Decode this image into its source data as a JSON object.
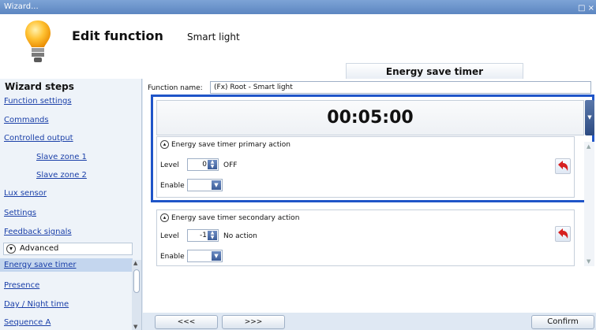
{
  "window": {
    "title": "Wizard...",
    "restore_glyph": "□ ×"
  },
  "header": {
    "title": "Edit function",
    "subtitle": "Smart light",
    "tab": "Energy save timer"
  },
  "sidebar": {
    "title": "Wizard steps",
    "items": [
      {
        "label": "Function settings"
      },
      {
        "label": "Commands"
      },
      {
        "label": "Controlled output"
      },
      {
        "label": "Slave zone 1"
      },
      {
        "label": "Slave zone 2"
      },
      {
        "label": "Lux sensor"
      },
      {
        "label": "Settings"
      },
      {
        "label": "Feedback signals"
      }
    ],
    "advanced_label": "Advanced",
    "advanced_items": [
      {
        "label": "Energy save timer"
      },
      {
        "label": "Presence"
      },
      {
        "label": "Day / Night time"
      },
      {
        "label": "Sequence A"
      }
    ]
  },
  "main": {
    "function_name_label": "Function name:",
    "function_name_value": "(Fx) Root - Smart light",
    "timer_value": "00:05:00",
    "primary": {
      "header": "Energy save timer primary action",
      "level_label": "Level",
      "level_value": "0",
      "level_state": "OFF",
      "enable_label": "Enable"
    },
    "secondary": {
      "header": "Energy save timer secondary action",
      "level_label": "Level",
      "level_value": "-1",
      "level_state": "No action",
      "enable_label": "Enable"
    }
  },
  "footer": {
    "prev_label": "<<<",
    "next_label": ">>>",
    "confirm_label": "Confirm"
  },
  "colors": {
    "accent": "#1f55c8",
    "titlebar": "#6b93cc",
    "link": "#1a3fa8",
    "reset_arrow": "#d62020"
  }
}
